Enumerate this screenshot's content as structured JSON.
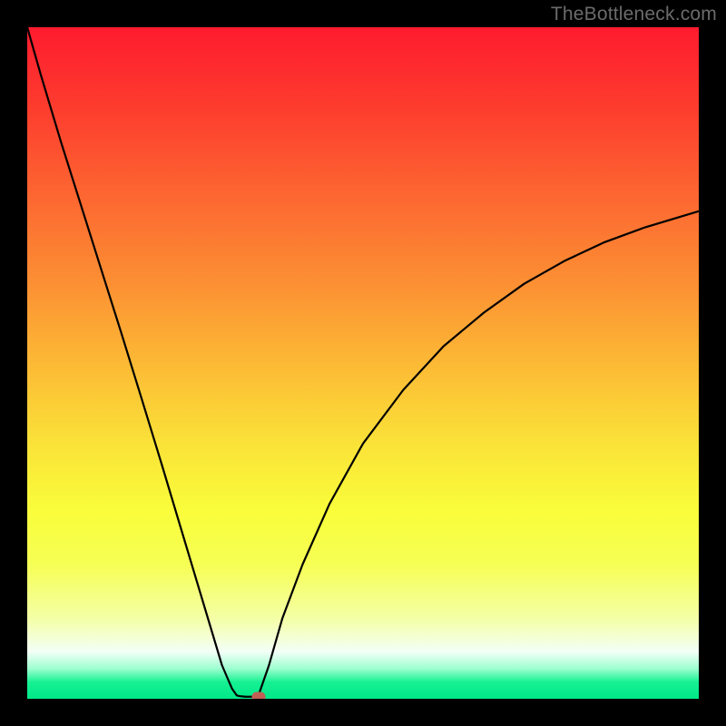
{
  "watermark": "TheBottleneck.com",
  "chart_data": {
    "type": "line",
    "title": "",
    "xlabel": "",
    "ylabel": "",
    "xlim": [
      0,
      1
    ],
    "ylim": [
      0,
      1
    ],
    "grid": false,
    "legend": false,
    "gradient_stops": [
      {
        "pos": 0.0,
        "color": "#fe1b2e"
      },
      {
        "pos": 0.12,
        "color": "#fd3c2e"
      },
      {
        "pos": 0.25,
        "color": "#fd6631"
      },
      {
        "pos": 0.38,
        "color": "#fc8f33"
      },
      {
        "pos": 0.5,
        "color": "#fcb935"
      },
      {
        "pos": 0.62,
        "color": "#fae238"
      },
      {
        "pos": 0.72,
        "color": "#f9fd3a"
      },
      {
        "pos": 0.8,
        "color": "#f6ff54"
      },
      {
        "pos": 0.88,
        "color": "#f4ffa6"
      },
      {
        "pos": 0.93,
        "color": "#f3fff7"
      },
      {
        "pos": 0.955,
        "color": "#9effd0"
      },
      {
        "pos": 0.975,
        "color": "#17f193"
      },
      {
        "pos": 1.0,
        "color": "#00e889"
      }
    ],
    "series": [
      {
        "name": "left-branch",
        "x": [
          0.0,
          0.02,
          0.05,
          0.08,
          0.11,
          0.14,
          0.17,
          0.2,
          0.23,
          0.26,
          0.29,
          0.305,
          0.312,
          0.316
        ],
        "y": [
          1.0,
          0.93,
          0.83,
          0.735,
          0.64,
          0.545,
          0.448,
          0.35,
          0.25,
          0.15,
          0.05,
          0.015,
          0.005,
          0.004
        ]
      },
      {
        "name": "flat-bottom",
        "x": [
          0.316,
          0.325,
          0.335,
          0.344
        ],
        "y": [
          0.004,
          0.003,
          0.003,
          0.004
        ]
      },
      {
        "name": "right-branch",
        "x": [
          0.344,
          0.36,
          0.38,
          0.41,
          0.45,
          0.5,
          0.56,
          0.62,
          0.68,
          0.74,
          0.8,
          0.86,
          0.92,
          0.98,
          1.0
        ],
        "y": [
          0.004,
          0.05,
          0.12,
          0.2,
          0.29,
          0.38,
          0.46,
          0.525,
          0.575,
          0.618,
          0.652,
          0.68,
          0.702,
          0.72,
          0.726
        ]
      }
    ],
    "marker": {
      "x": 0.344,
      "y": 0.003,
      "color": "#c06055"
    }
  }
}
